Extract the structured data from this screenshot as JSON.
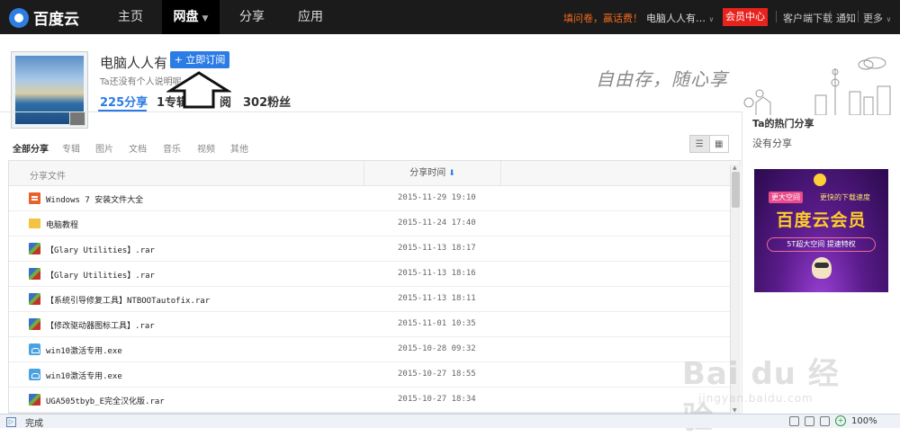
{
  "topbar": {
    "logo_text": "百度云",
    "nav": [
      {
        "label": "主页"
      },
      {
        "label": "网盘"
      },
      {
        "label": "分享"
      },
      {
        "label": "应用"
      }
    ],
    "promo": "填问卷，赢话费！",
    "user": "电脑人人有…",
    "vip_button": "会员中心",
    "links": [
      "客户端下载",
      "通知",
      "更多"
    ]
  },
  "profile": {
    "name": "电脑人人有",
    "subscribe_button": "+ 立即订阅",
    "description": "Ta还没有个人说明呢",
    "stats": [
      "225分享",
      "1专辑",
      "阅",
      "302粉丝"
    ],
    "slogan": "自由存，随心享"
  },
  "categories": [
    "全部分享",
    "专辑",
    "图片",
    "文档",
    "音乐",
    "视频",
    "其他"
  ],
  "table": {
    "col_name": "分享文件",
    "col_time": "分享时间",
    "rows": [
      {
        "icon": "doc",
        "name": "Windows 7 安装文件大全",
        "time": "2015-11-29 19:10"
      },
      {
        "icon": "folder",
        "name": "电脑教程",
        "time": "2015-11-24 17:40"
      },
      {
        "icon": "rar",
        "name": "【Glary Utilities】.rar",
        "time": "2015-11-13 18:17"
      },
      {
        "icon": "rar",
        "name": "【Glary Utilities】.rar",
        "time": "2015-11-13 18:16"
      },
      {
        "icon": "rar",
        "name": "【系统引导修复工具】NTBOOTautofix.rar",
        "time": "2015-11-13 18:11"
      },
      {
        "icon": "rar",
        "name": "【修改驱动器图标工具】.rar",
        "time": "2015-11-01 10:35"
      },
      {
        "icon": "exe",
        "name": "win10激活专用.exe",
        "time": "2015-10-28 09:32"
      },
      {
        "icon": "exe",
        "name": "win10激活专用.exe",
        "time": "2015-10-27 18:55"
      },
      {
        "icon": "rar",
        "name": "UGA505tbyb_E完全汉化版.rar",
        "time": "2015-10-27 18:34"
      }
    ]
  },
  "sidebar": {
    "hot_title": "Ta的热门分享",
    "hot_empty": "没有分享",
    "ad_tag_left": "更大空间",
    "ad_tag_right": "更快的下载速度",
    "ad_title": "百度云会员",
    "ad_sub": "5T超大空间  提速特权"
  },
  "watermark": {
    "text": "Bai du 经验",
    "url": "jingyan.baidu.com"
  },
  "statusbar": {
    "left": "完成",
    "zoom": "100%"
  }
}
